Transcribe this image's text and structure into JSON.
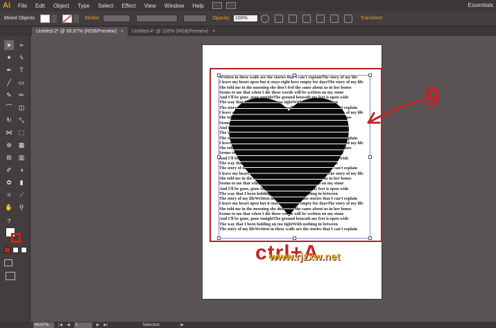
{
  "app": {
    "logo": "Ai",
    "workspace": "Essentials"
  },
  "menu": [
    "File",
    "Edit",
    "Object",
    "Type",
    "Select",
    "Effect",
    "View",
    "Window",
    "Help"
  ],
  "control": {
    "selection_label": "Mixed Objects",
    "stroke_label": "Stroke:",
    "opacity_label": "Opacity:",
    "opacity_value": "100%",
    "transform_label": "Transform"
  },
  "tabs": [
    {
      "label": "Untitled-2* @ 66.67% (RGB/Preview)",
      "active": true
    },
    {
      "label": "Untitled-4* @ 100% (RGB/Preview)",
      "active": false
    }
  ],
  "document": {
    "text_lines": [
      "Written in these walls are the stories that I can't explainThe story of my life",
      "I leave my heart open but it stays right here empty for daysThe story of my life",
      "She told me in the morning she don't feel the same about us in her bones",
      "Seems to me that when I die these words will be written on my stone",
      "And I'll be gone, gone tonightThe ground beneath my feet is open wide",
      "The way that I been holding on too tightWith nothing in between",
      "The story of my lifeWritten in these walls are the stories that I can't explain",
      "I leave my heart open but it stays right here empty for daysThe story of my life",
      "She told me in the morning she don't feel the same about us in her bones",
      "Seems to me that when I die these words will be written on my stone",
      "And I'll be gone, gone tonightThe ground beneath my feet is open wide",
      "The way that I been holding on too tightWith nothing in between",
      "The story of my lifeWritten in these walls are the stories that I can't explain",
      "I leave my heart open but it stays right here empty for daysThe story of my life",
      "She told me in the morning she don't feel the same about us in her bones",
      "Seems to me that when I die these words will be written on my stone",
      "And I'll be gone, gone tonightThe ground beneath my feet is open wide",
      "The way that I been holding on too tightWith nothing in between",
      "The story of my lifeWritten in these walls are the stories that I can't explain",
      "I leave my heart open but it stays right here empty for daysThe story of my life",
      "She told me in the morning she don't feel the same about us in her bones",
      "Seems to me that when I die these words will be written on my stone",
      "And I'll be gone, gone tonightThe ground beneath my feet is open wide",
      "The way that I been holding on too tightWith nothing in between",
      "The story of my lifeWritten in these walls are the stories that I can't explain",
      "I leave my heart open but it stays right here empty for daysThe story of my life",
      "She told me in the morning she don't feel the same about us in her bones",
      "Seems to me that when I die these words will be written on my stone",
      "And I'll be gone, gone tonightThe ground beneath my feet is open wide",
      "The way that I been holding on too tightWith nothing in between",
      "The story of my lifeWritten in these walls are the stories that I can't explain"
    ],
    "overlay_text": "ctrl+A",
    "watermark": "www.rjzxw.net",
    "annotation_number": "9"
  },
  "status": {
    "zoom": "66.67%",
    "page": "1",
    "mode": "Selection"
  },
  "colors": {
    "accent": "#f0a020",
    "highlight": "#b02020",
    "heart": "#0a0a0a"
  }
}
